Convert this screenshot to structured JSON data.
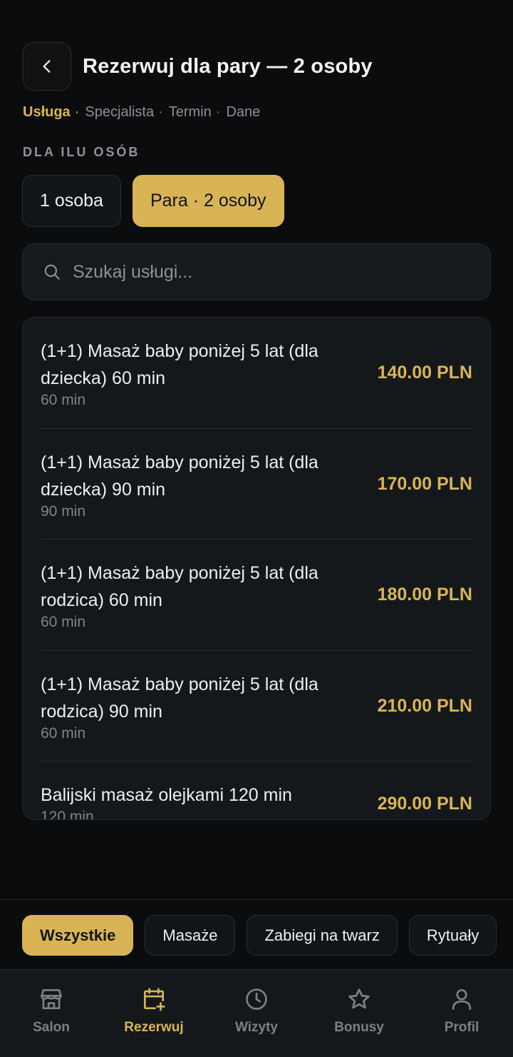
{
  "header": {
    "title": "Rezerwuj dla pary — 2 osoby"
  },
  "steps": [
    {
      "label": "Usługa",
      "active": true
    },
    {
      "label": "Specjalista",
      "active": false
    },
    {
      "label": "Termin",
      "active": false
    },
    {
      "label": "Dane",
      "active": false
    }
  ],
  "persons": {
    "section_label": "DLA ILU OSÓB",
    "options": [
      "1 osoba",
      "Para · 2 osoby"
    ],
    "selected": "Para · 2 osoby"
  },
  "search": {
    "placeholder": "Szukaj usługi...",
    "value": ""
  },
  "services": [
    {
      "name": "(1+1) Masaż baby poniżej 5 lat (dla dziecka) 60 min",
      "duration": "60 min",
      "price": "140.00 PLN"
    },
    {
      "name": "(1+1) Masaż baby poniżej 5 lat (dla dziecka) 90 min",
      "duration": "90 min",
      "price": "170.00 PLN"
    },
    {
      "name": "(1+1) Masaż baby poniżej 5 lat (dla rodzica) 60 min",
      "duration": "60 min",
      "price": "180.00 PLN"
    },
    {
      "name": "(1+1) Masaż baby poniżej 5 lat (dla rodzica) 90 min",
      "duration": "60 min",
      "price": "210.00 PLN"
    },
    {
      "name": "Balijski masaż olejkami 120 min",
      "duration": "120 min",
      "price": "290.00 PLN"
    }
  ],
  "categories": [
    "Wszystkie",
    "Masaże",
    "Zabiegi na twarz",
    "Rytuały"
  ],
  "active_category": "Wszystkie",
  "tabs": [
    {
      "label": "Salon",
      "icon": "store-icon"
    },
    {
      "label": "Rezerwuj",
      "icon": "calendar-plus-icon"
    },
    {
      "label": "Wizyty",
      "icon": "clock-icon"
    },
    {
      "label": "Bonusy",
      "icon": "star-icon"
    },
    {
      "label": "Profil",
      "icon": "user-icon"
    }
  ],
  "active_tab": "Rezerwuj",
  "colors": {
    "accent": "#d8b457",
    "background": "#0b0c0d",
    "surface": "#15181b",
    "muted": "#7c8085"
  }
}
